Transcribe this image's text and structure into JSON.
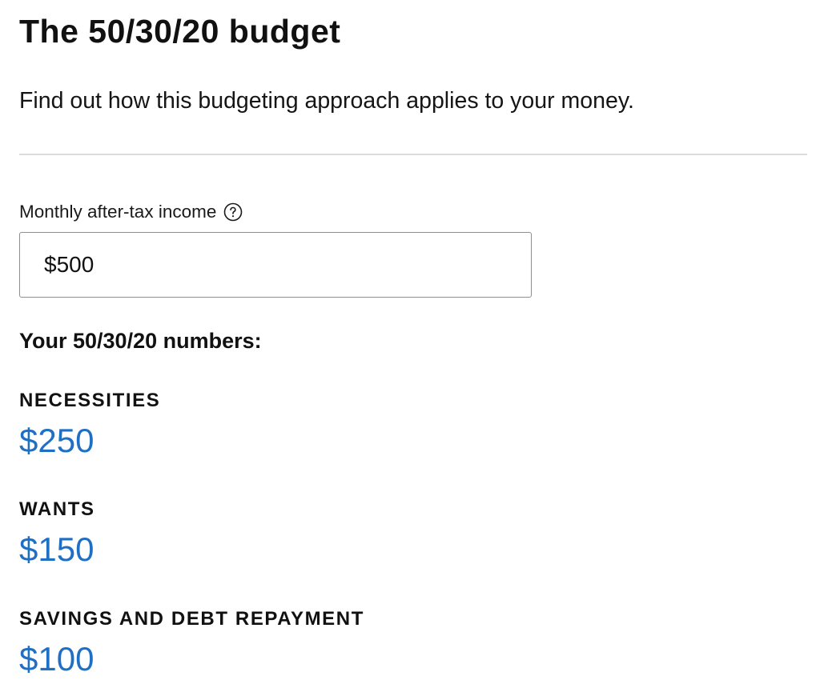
{
  "header": {
    "title": "The 50/30/20 budget",
    "subtitle": "Find out how this budgeting approach applies to your money."
  },
  "income": {
    "label": "Monthly after-tax income",
    "help_icon": "question-circle-icon",
    "value": "$500"
  },
  "results": {
    "heading": "Your 50/30/20 numbers:",
    "categories": [
      {
        "label": "NECESSITIES",
        "value": "$250"
      },
      {
        "label": "WANTS",
        "value": "$150"
      },
      {
        "label": "SAVINGS AND DEBT REPAYMENT",
        "value": "$100"
      }
    ]
  },
  "colors": {
    "accent": "#1f6fc4",
    "text": "#111111",
    "divider": "#dcdcdc",
    "input_border": "#8f8f8f"
  }
}
